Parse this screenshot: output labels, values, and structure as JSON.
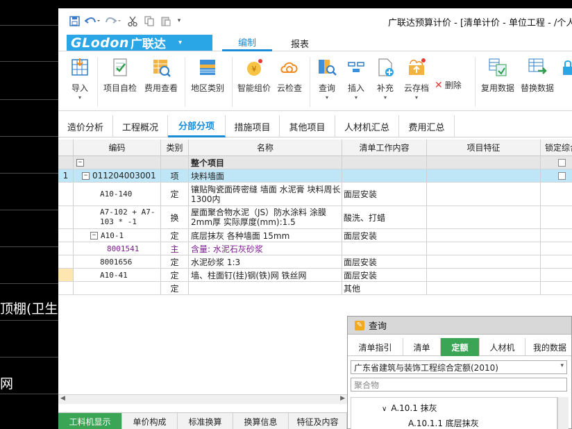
{
  "window": {
    "title": "广联达预算计价 - [清单计价 - 单位工程 - /个人空"
  },
  "background_text": {
    "line1": "顶棚(卫生间",
    "line2": "网"
  },
  "quick_access": {
    "save": "save-icon",
    "undo": "undo-icon",
    "redo": "redo-icon",
    "cut": "cut-icon",
    "copy": "copy-icon",
    "paste": "paste-icon",
    "more": "more-icon"
  },
  "brand": {
    "logo_text": "GLodon",
    "logo_cn": "广联达",
    "dropdown": "▾"
  },
  "ribbon_tabs": [
    {
      "label": "编制",
      "active": true
    },
    {
      "label": "报表",
      "active": false
    }
  ],
  "ribbon": {
    "import": "导入",
    "self_check": "项目自检",
    "fee_view": "费用查看",
    "area_category": "地区类别",
    "smart_price": "智能组价",
    "cloud_check": "云检查",
    "query": "查询",
    "insert": "插入",
    "supplement": "补充",
    "cloud_save": "云存档",
    "delete": "删除",
    "reuse_data": "复用数据",
    "replace_data": "替换数据"
  },
  "subtabs": [
    "造价分析",
    "工程概况",
    "分部分项",
    "措施项目",
    "其他项目",
    "人材机汇总",
    "费用汇总"
  ],
  "table": {
    "headers": {
      "code": "编码",
      "type": "类别",
      "name": "名称",
      "work": "清单工作内容",
      "feature": "项目特征",
      "lock": "锁定综合"
    },
    "rows": [
      {
        "idx": "",
        "toggle": "−",
        "code": "",
        "type": "",
        "name": "整个项目",
        "work": "",
        "feature": "",
        "lock": true
      },
      {
        "idx": "1",
        "toggle": "−",
        "code": "011204003001",
        "type": "项",
        "name": "块料墙面",
        "work": "",
        "feature": "",
        "lock": true
      },
      {
        "idx": "",
        "toggle": "",
        "code": "A10-140",
        "type": "定",
        "name": "镶贴陶瓷面砖密缝 墙面 水泥膏 块料周长1300内",
        "work": "面层安装",
        "feature": ""
      },
      {
        "idx": "",
        "toggle": "",
        "code": "A7-102 + A7-103 * -1",
        "type": "换",
        "name": "屋面聚合物水泥（JS）防水涂料 涂膜2mm厚  实际厚度(mm):1.5",
        "work": "酸洗、打蜡",
        "feature": ""
      },
      {
        "idx": "",
        "toggle": "−",
        "code": "A10-1",
        "type": "定",
        "name": "底层抹灰 各种墙面 15mm",
        "work": "面层安装",
        "feature": ""
      },
      {
        "idx": "",
        "toggle": "",
        "code": "8001541",
        "type": "主",
        "name": "含量: 水泥石灰砂浆",
        "work": "",
        "feature": ""
      },
      {
        "idx": "",
        "toggle": "",
        "code": "8001656",
        "type": "定",
        "name": "水泥砂浆 1:3",
        "work": "面层安装",
        "feature": ""
      },
      {
        "idx": "",
        "toggle": "",
        "code": "A10-41",
        "type": "定",
        "name": "墙、柱面钉(挂)钢(铁)网 铁丝网",
        "work": "面层安装",
        "feature": ""
      },
      {
        "idx": "",
        "toggle": "",
        "code": "",
        "type": "定",
        "name": "",
        "work": "其他",
        "feature": ""
      }
    ]
  },
  "bottom_tabs": [
    "工料机显示",
    "单价构成",
    "标准换算",
    "换算信息",
    "特征及内容"
  ],
  "query_panel": {
    "title": "查询",
    "tabs": [
      "清单指引",
      "清单",
      "定额",
      "人材机",
      "我的数据"
    ],
    "active_tab": "定额",
    "selected_db": "广东省建筑与装饰工程综合定额(2010)",
    "search_placeholder": "聚合物",
    "tree": [
      {
        "label": "A.10.1 抹灰",
        "expanded": true
      },
      {
        "label": "A.10.1.1 底层抹灰"
      }
    ]
  },
  "colors": {
    "brand_blue": "#2aa6e6",
    "accent_blue": "#1a8bd6",
    "selected_row": "#bfe6f6",
    "green_tab": "#3aa655",
    "purple_text": "#7a1a8c"
  }
}
